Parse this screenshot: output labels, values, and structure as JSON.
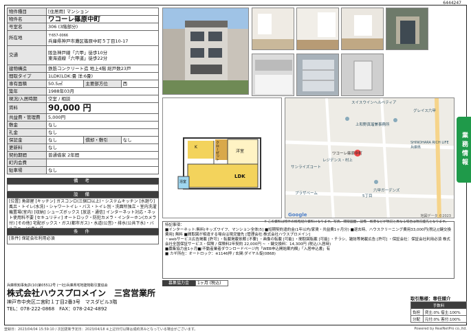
{
  "doc_id": "6444247",
  "property": {
    "type_label": "物件種目",
    "type_value": "[住居用] マンション",
    "name_label": "物件名",
    "name_value": "ワコーレ篠原中町",
    "room_label": "号室名",
    "room_value": "306 (3階部分)",
    "address_label": "所在地",
    "postal": "〒657-0066",
    "address": "兵庫県神戸市灘区篠原中町５丁目10-17",
    "transport_label": "交通",
    "transport_1": "阪急神戸線「六甲」徒歩10分",
    "transport_2": "東海道線「六甲道」徒歩22分",
    "structure_label": "建物構造",
    "structure_value": "鉄筋コンクリート造 地上4階 総戸数23戸",
    "layout_label": "間取タイプ",
    "layout_value": "1LDK(LDK:畳 洋:6畳)",
    "area_label": "専有面積",
    "area_value": "50.5㎡",
    "direction_label": "主要部方位",
    "direction_value": "西",
    "built_label": "築年",
    "built_value": "1988年03月",
    "status_label": "現況/入居時期",
    "status_value": "空室 / 相談",
    "rent_label": "賃料",
    "rent_value": "90,000 円",
    "fee_label": "共益費・管理費",
    "fee_value": "5,000円",
    "deposit_label": "敷金",
    "deposit_value": "なし",
    "key_label": "礼金",
    "key_value": "なし",
    "guarantee_label": "保証金",
    "guarantee_value": "なし",
    "amort_label": "償却・敷引",
    "amort_value": "なし",
    "renew_label": "更新料",
    "renew_value": "なし",
    "contract_label": "契約期間",
    "contract_value": "普通借家 2年間",
    "assoc_label": "町内会費",
    "assoc_value": "",
    "parking_label": "駐車場",
    "parking_value": "なし"
  },
  "notes_head": "備 考",
  "facilities_head": "設 備",
  "facilities_text": "[位置] 角部屋 [キッチン] ガスコンロ(三個口以上)・システムキッチン [水廻り] 風呂・トイレ(水洗)・シャワートイレ・バス・トイレ別・洗面所独立・室内洗濯機置場(室内) [収納] シューズボックス [放送・通信] インターネット対応・ネット使用料不要 [セキュリティ] オートロック・防犯カメラ・インターホン(カメラ付) [その他] 宅配ボックス・ガス(都市ガス)・水道(公営)・排水(公共下水)・バルコニー/ベランダ",
  "conditions_head": "条 件",
  "conditions_text": "[条件] 保証会社利用必須",
  "floorplan": {
    "label_kitchen": "K",
    "label_western": "洋室",
    "label_closet": "クローゼット",
    "label_ldk": "LDK",
    "label_bath": "浴室"
  },
  "map": {
    "label_1": "スイスウインヘルベティア",
    "label_2": "上和野真瑠兼事務所",
    "label_3": "ワコーレ篠原中町",
    "label_4": "レジデンス・村上",
    "label_5": "グレイス六甲",
    "label_6": "SHINOHARA RICH LIFE 兵庫県",
    "label_7": "プラザベーム",
    "label_8": "六甲ガーデンズ",
    "label_9": "5丁目",
    "label_10": "サンライズコート",
    "google": "Google",
    "copyright": "地図データ ©2023"
  },
  "map_note": "※ この資料は物件の概略紹介資料になります。写真、間取図面、設備・概要などが現況と異なる場合は現況優先となります。",
  "side_tab": "業務情報",
  "remarks": {
    "title": "特記事項：",
    "line_1": "■インターネット:無料(キッズワイフ、マンション全体)5] ■短期契約違約金(1年以内/家賃・共益費1ヶ月分) ■退去時、ハウスクリーニング費用33,000円(税込)[鍵交換費用] 無料 ■間取図が相違する場合は現況優先 [管理会社:株式会社ハウスプロメイン]",
    "line_2": "・webサービス広告掲載 [許可] ・転載掲載依頼 [不要] ・画像の転載 [可能] ・間取図転載 [可能] ・チラシ、雑誌等掲載広告 [許可] ・保証会社：保証会社利用必須 株式会社全国保証サービス・保険 / 保険料2年契約 22,000円 ~ ・鍵交換料：14,300円 (税込/入居時)",
    "line_3": "■募集協力金1ヶ月■/不動産業者ダウンロードページ内「WEB申込開始案内欄」「入居申込書」有",
    "line_4": "■ カギ所在：オートロック：※1146押 / 玄関:ダイヤル錠(0868)"
  },
  "commission_label": "募集協力金",
  "commission_value": "1ヶ月 (税込)",
  "company": {
    "license": "兵庫県知事免許(10)第05512号 (一社)兵庫県宅地建物取引業協会",
    "name": "株式会社ハウスプロメイン　三宮営業所",
    "address": "神戸市中央区二宮町１丁目2番3号　マスダビル3階",
    "tel": "TEL：078-222-0868　FAX：078-242-4892"
  },
  "fee": {
    "type": "取引態様：専任媒介",
    "head": "手数料",
    "r1_label": "負担",
    "r1_value": "貸主:0% 借主:100%",
    "r2_label": "分配",
    "r2_value": "元付:0% 客付:100%"
  },
  "footer": {
    "left": "登録日：2023/04/04 15:59:10 / 次回更新予定日：2023/04/18 ※上記日付以降は成約済みとなっている場合がございます。",
    "right": "Powered by RealNetPro co.,ltd."
  }
}
